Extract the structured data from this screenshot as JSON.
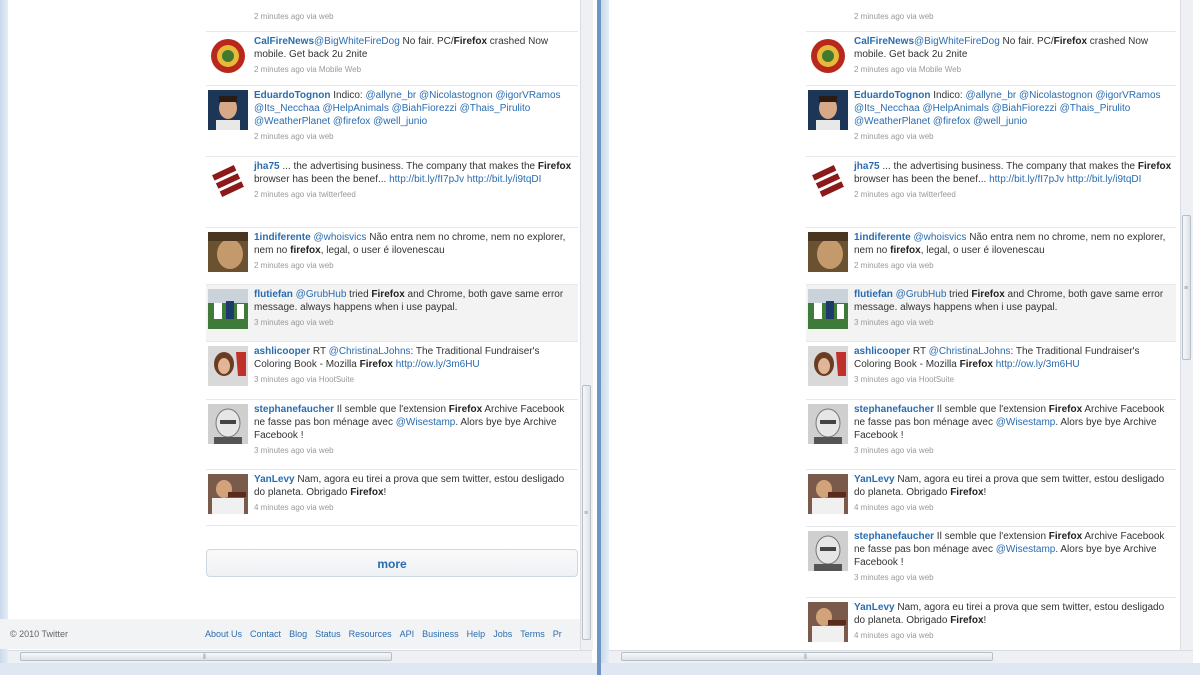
{
  "timeline": {
    "top_partial": {
      "meta": "2 minutes ago via web"
    },
    "tweets": [
      {
        "user": "CalFireNews",
        "parts": [
          [
            "m",
            "@BigWhiteFireDog"
          ],
          [
            "t",
            " No fair. PC/"
          ],
          [
            "k",
            "Firefox"
          ],
          [
            "t",
            " crashed Now mobile. Get back 2u 2nite"
          ]
        ],
        "meta": "2 minutes ago via Mobile Web"
      },
      {
        "user": "EduardoTognon",
        "parts": [
          [
            "t",
            " Indico: "
          ],
          [
            "m",
            "@allyne_br"
          ],
          [
            "t",
            " "
          ],
          [
            "m",
            "@Nicolastognon"
          ],
          [
            "t",
            " "
          ],
          [
            "m",
            "@igorVRamos"
          ],
          [
            "t",
            " "
          ],
          [
            "m",
            "@Its_Necchaa"
          ],
          [
            "t",
            " "
          ],
          [
            "m",
            "@HelpAnimals"
          ],
          [
            "t",
            " "
          ],
          [
            "m",
            "@BiahFiorezzi"
          ],
          [
            "t",
            " "
          ],
          [
            "m",
            "@Thais_Pirulito"
          ],
          [
            "t",
            " "
          ],
          [
            "m",
            "@WeatherPlanet"
          ],
          [
            "t",
            " "
          ],
          [
            "m",
            "@firefox"
          ],
          [
            "t",
            " "
          ],
          [
            "m",
            "@well_junio"
          ]
        ],
        "meta": "2 minutes ago via web"
      },
      {
        "user": "jha75",
        "parts": [
          [
            "t",
            " ... the advertising business. The company that makes the "
          ],
          [
            "k",
            "Firefox"
          ],
          [
            "t",
            " browser has been the benef... "
          ],
          [
            "l",
            "http://bit.ly/fI7pJv"
          ],
          [
            "t",
            " "
          ],
          [
            "l",
            "http://bit.ly/i9tqDI"
          ]
        ],
        "meta": "2 minutes ago via twitterfeed"
      },
      {
        "user": "1indiferente",
        "parts": [
          [
            "t",
            " "
          ],
          [
            "m",
            "@whoisvics"
          ],
          [
            "t",
            " Não entra nem no chrome, nem no explorer, nem no "
          ],
          [
            "k",
            "firefox"
          ],
          [
            "t",
            ", legal, o user é ilovenescau"
          ]
        ],
        "meta": "2 minutes ago via web"
      },
      {
        "user": "flutiefan",
        "parts": [
          [
            "t",
            " "
          ],
          [
            "m",
            "@GrubHub"
          ],
          [
            "t",
            " tried "
          ],
          [
            "k",
            "Firefox"
          ],
          [
            "t",
            " and Chrome, both gave same error message. always happens when i use paypal."
          ]
        ],
        "meta": "3 minutes ago via web"
      },
      {
        "user": "ashlicooper",
        "parts": [
          [
            "t",
            " RT "
          ],
          [
            "m",
            "@ChristinaLJohns"
          ],
          [
            "t",
            ": The Traditional Fundraiser's Coloring Book - Mozilla "
          ],
          [
            "k",
            "Firefox"
          ],
          [
            "t",
            " "
          ],
          [
            "l",
            "http://ow.ly/3m6HU"
          ]
        ],
        "meta": "3 minutes ago via HootSuite"
      },
      {
        "user": "stephanefaucher",
        "parts": [
          [
            "t",
            " Il semble que l'extension "
          ],
          [
            "k",
            "Firefox"
          ],
          [
            "t",
            " Archive Facebook ne fasse pas bon ménage avec "
          ],
          [
            "m",
            "@Wisestamp"
          ],
          [
            "t",
            ". Alors bye bye Archive Facebook !"
          ]
        ],
        "meta": "3 minutes ago via web"
      },
      {
        "user": "YanLevy",
        "parts": [
          [
            "t",
            " Nam, agora eu tirei a prova que sem twitter, estou desligado do planeta. Obrigado "
          ],
          [
            "k",
            "Firefox"
          ],
          [
            "t",
            "!"
          ]
        ],
        "meta": "4 minutes ago via web"
      }
    ]
  },
  "more_label": "more",
  "footer": {
    "copyright": "© 2010 Twitter",
    "links": [
      "About Us",
      "Contact",
      "Blog",
      "Status",
      "Resources",
      "API",
      "Business",
      "Help",
      "Jobs",
      "Terms",
      "Pr"
    ]
  },
  "colors": {
    "link": "#2a6cb0",
    "meta": "#999999",
    "desktop": "#5d86b6",
    "highlight_row": "#f3f3f3"
  },
  "avatars": [
    "fire-badge-avatar",
    "man-avatar",
    "sign-avatar",
    "face-avatar",
    "football-avatar",
    "woman-avatar",
    "bald-man-avatar",
    "guitar-avatar"
  ]
}
